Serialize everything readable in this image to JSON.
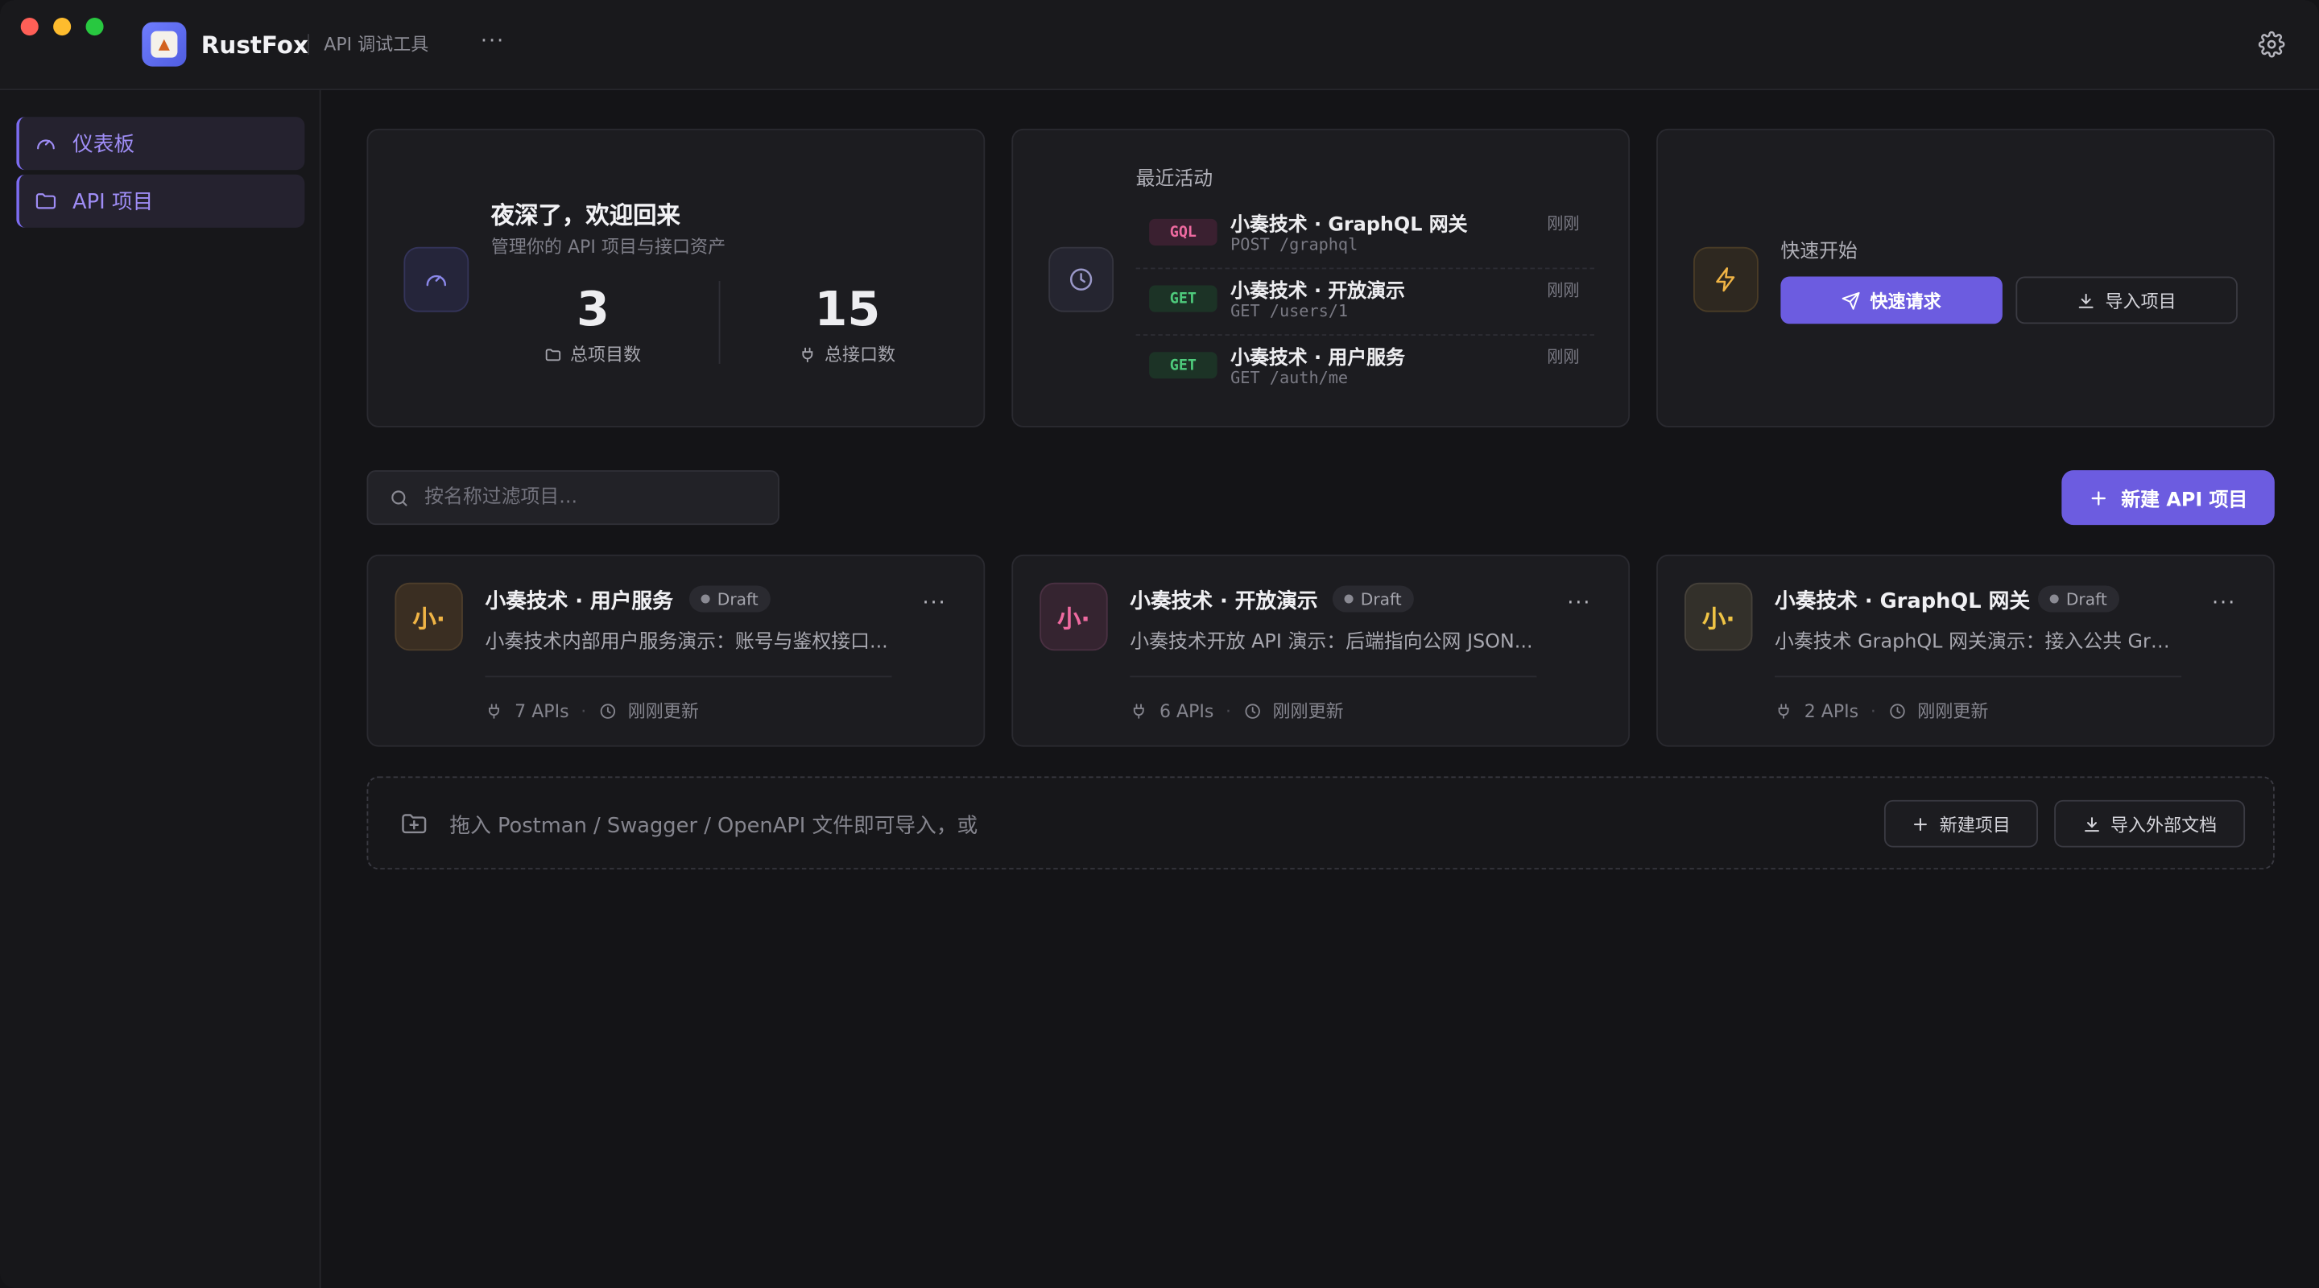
{
  "app": {
    "name": "RustFox",
    "subtitle": "API 调试工具",
    "more_label": "···"
  },
  "sidebar": {
    "items": [
      {
        "label": "仪表板",
        "icon": "gauge-icon"
      },
      {
        "label": "API 项目",
        "icon": "folder-icon"
      }
    ]
  },
  "welcome": {
    "title": "夜深了，欢迎回来",
    "subtitle": "管理你的 API 项目与接口资产",
    "stats": [
      {
        "value": "3",
        "label": "总项目数",
        "icon": "folder-icon"
      },
      {
        "value": "15",
        "label": "总接口数",
        "icon": "plug-icon"
      }
    ]
  },
  "activity": {
    "title": "最近活动",
    "items": [
      {
        "method": "GQL",
        "name": "小奏技术 · GraphQL 网关",
        "path": "POST /graphql",
        "time": "刚刚"
      },
      {
        "method": "GET",
        "name": "小奏技术 · 开放演示",
        "path": "GET /users/1",
        "time": "刚刚"
      },
      {
        "method": "GET",
        "name": "小奏技术 · 用户服务",
        "path": "GET /auth/me",
        "time": "刚刚"
      }
    ]
  },
  "quick_start": {
    "title": "快速开始",
    "primary_label": "快速请求",
    "import_label": "导入项目"
  },
  "search": {
    "placeholder": "按名称过滤项目..."
  },
  "new_api_label": "新建 API 项目",
  "projects": [
    {
      "avatar": "小·",
      "name": "小奏技术 · 用户服务",
      "status": "Draft",
      "desc": "小奏技术内部用户服务演示：账号与鉴权接口...",
      "apis": "7 APIs",
      "updated": "刚刚更新",
      "menu": "···"
    },
    {
      "avatar": "小·",
      "name": "小奏技术 · 开放演示",
      "status": "Draft",
      "desc": "小奏技术开放 API 演示：后端指向公网 JSON...",
      "apis": "6 APIs",
      "updated": "刚刚更新",
      "menu": "···"
    },
    {
      "avatar": "小·",
      "name": "小奏技术 · GraphQL 网关",
      "status": "Draft",
      "desc": "小奏技术 GraphQL 网关演示：接入公共 Grap...",
      "apis": "2 APIs",
      "updated": "刚刚更新",
      "menu": "···"
    }
  ],
  "dropzone": {
    "text": "拖入 Postman / Swagger / OpenAPI 文件即可导入，或",
    "new_label": "新建项目",
    "import_label": "导入外部文档"
  },
  "colors": {
    "accent": "#6c5ce0",
    "accent_text": "#9f8df6",
    "get": "#4ecb7c",
    "gql": "#ee6aa0"
  }
}
